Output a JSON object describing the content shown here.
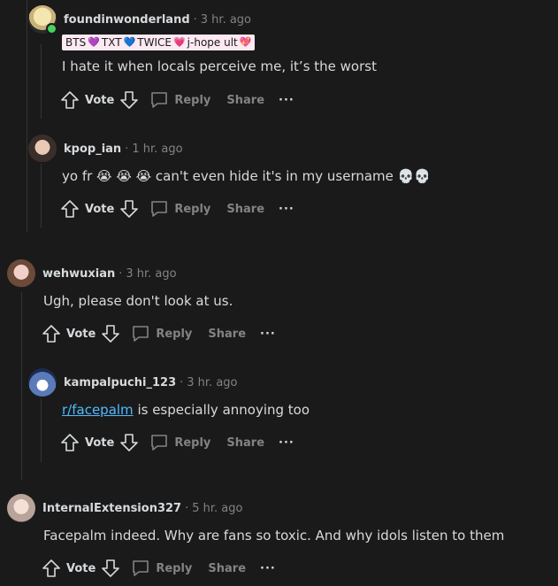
{
  "comments": [
    {
      "username": "foundinwonderland",
      "time": "3 hr. ago",
      "flair": [
        "BTS",
        "💜",
        "TXT",
        "💙",
        "TWICE",
        "💗",
        "j-hope ult",
        "💖"
      ],
      "body": "I hate it when locals perceive me, it’s the worst",
      "vote_label": "Vote",
      "reply_label": "Reply",
      "share_label": "Share",
      "more_label": "···"
    },
    {
      "username": "kpop_ian",
      "time": "1 hr. ago",
      "body": "yo fr 😭 😭 😭  can't even hide it's in my username 💀💀",
      "vote_label": "Vote",
      "reply_label": "Reply",
      "share_label": "Share",
      "more_label": "···"
    },
    {
      "username": "wehwuxian",
      "time": "3 hr. ago",
      "body": "Ugh, please don't look at us.",
      "vote_label": "Vote",
      "reply_label": "Reply",
      "share_label": "Share",
      "more_label": "···"
    },
    {
      "username": "kampalpuchi_123",
      "time": "3 hr. ago",
      "body_link": "r/facepalm",
      "body_rest": " is especially annoying too",
      "vote_label": "Vote",
      "reply_label": "Reply",
      "share_label": "Share",
      "more_label": "···"
    },
    {
      "username": "InternalExtension327",
      "time": "5 hr. ago",
      "body": "Facepalm indeed. Why are fans so toxic. And why idols listen to them",
      "vote_label": "Vote",
      "reply_label": "Reply",
      "share_label": "Share",
      "more_label": "···"
    }
  ],
  "colors": {
    "background": "#1a1a1b",
    "text": "#d7dadc",
    "muted": "#818384",
    "link": "#4fbcff",
    "flair_bg": "#fce9f1",
    "online": "#46d160"
  }
}
